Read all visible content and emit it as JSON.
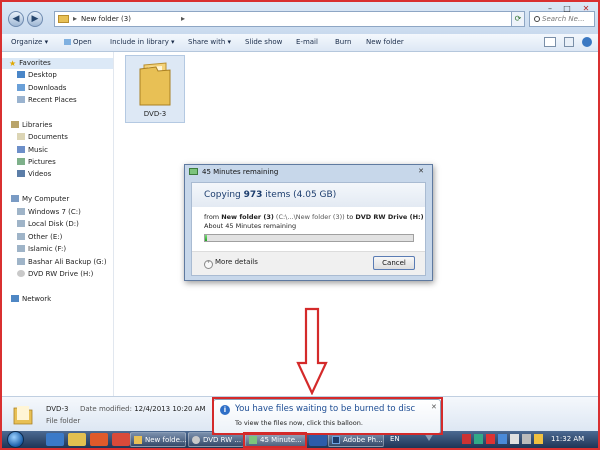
{
  "address": {
    "path": "New folder (3)",
    "search_placeholder": "Search Ne..."
  },
  "window_controls": {
    "minimize": "–",
    "maximize": "□",
    "close": "✕"
  },
  "toolbar": {
    "items": [
      "Organize ▾",
      "Open",
      "Include in library ▾",
      "Share with ▾",
      "Slide show",
      "E-mail",
      "Burn",
      "New folder"
    ]
  },
  "nav": {
    "favorites": "Favorites",
    "desktop": "Desktop",
    "downloads": "Downloads",
    "recent": "Recent Places",
    "libraries": "Libraries",
    "documents": "Documents",
    "music": "Music",
    "pictures": "Pictures",
    "videos": "Videos",
    "computer": "My Computer",
    "drive_c": "Windows 7 (C:)",
    "drive_d": "Local Disk (D:)",
    "drive_e": "Other (E:)",
    "drive_f": "Islamic (F:)",
    "drive_g": "Bashar Ali Backup (G:)",
    "drive_h": "DVD RW Drive (H:)",
    "network": "Network"
  },
  "content": {
    "folder_name": "DVD-3"
  },
  "details": {
    "name": "DVD-3",
    "type": "File folder",
    "modified_label": "Date modified:",
    "modified_value": "12/4/2013 10:20 AM"
  },
  "dialog": {
    "title": "45 Minutes remaining",
    "heading_prefix": "Copying ",
    "heading_count": "973",
    "heading_suffix": " items (4.05 GB)",
    "from_label": "from ",
    "from_name": "New folder (3)",
    "from_path": " (C:\\...\\New folder (3)) ",
    "to_label": " to ",
    "to_name": "DVD RW Drive (H:)",
    "remaining": "About 45 Minutes remaining",
    "progress": 0.01,
    "more_details": "More details",
    "cancel": "Cancel"
  },
  "balloon": {
    "title": "You have files waiting to be burned to disc",
    "text": "To view the files now, click this balloon."
  },
  "taskbar": {
    "task_explorer": "New folde...",
    "task_dvd": "DVD RW ...",
    "task_copy": "45 Minute...",
    "task_adobe": "Adobe Ph...",
    "lang": "EN",
    "clock": "11:32 AM"
  },
  "colors": {
    "accent_red": "#d42a2a",
    "progress_green": "#1fa21f",
    "folder_yellow": "#e8c055"
  }
}
